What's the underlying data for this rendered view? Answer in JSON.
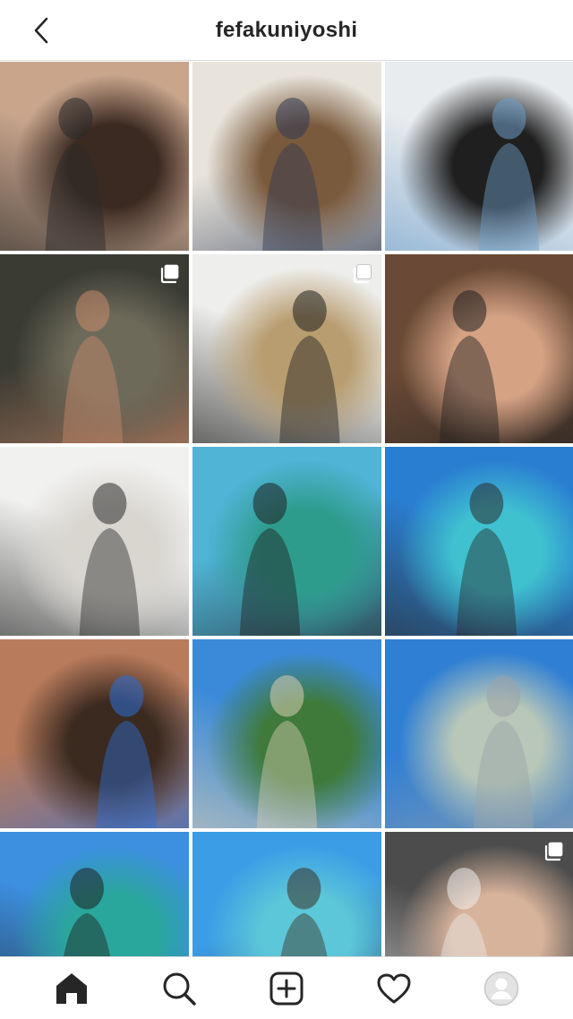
{
  "header": {
    "username": "fefakuniyoshi",
    "back_icon": "chevron-left-icon"
  },
  "posts": [
    {
      "id": 1,
      "multi": false,
      "colors": [
        "#c9a58c",
        "#3b2a22",
        "#2a2a2a"
      ]
    },
    {
      "id": 2,
      "multi": false,
      "colors": [
        "#e8e4dc",
        "#7a5a3c",
        "#2f3a55"
      ]
    },
    {
      "id": 3,
      "multi": false,
      "colors": [
        "#e9ecef",
        "#1f1f1f",
        "#6e9fc9"
      ]
    },
    {
      "id": 4,
      "multi": true,
      "colors": [
        "#3a3b33",
        "#6d6a5a",
        "#c98a6a"
      ]
    },
    {
      "id": 5,
      "multi": true,
      "colors": [
        "#eeeeec",
        "#b89d70",
        "#1f1f1f"
      ]
    },
    {
      "id": 6,
      "multi": false,
      "colors": [
        "#6a4a36",
        "#d5a284",
        "#1f1f1f"
      ]
    },
    {
      "id": 7,
      "multi": false,
      "colors": [
        "#f1f1f0",
        "#d9d6d0",
        "#2b2b2b"
      ]
    },
    {
      "id": 8,
      "multi": false,
      "colors": [
        "#4fb4d6",
        "#2e9c8d",
        "#1f1f1f"
      ]
    },
    {
      "id": 9,
      "multi": false,
      "colors": [
        "#2a7ed1",
        "#3fc1d0",
        "#2b2b2b"
      ]
    },
    {
      "id": 10,
      "multi": false,
      "colors": [
        "#b87b5c",
        "#3b2a20",
        "#2c6ed6"
      ]
    },
    {
      "id": 11,
      "multi": false,
      "colors": [
        "#3b8ad9",
        "#3f7a3a",
        "#d8cdb4"
      ]
    },
    {
      "id": 12,
      "multi": false,
      "colors": [
        "#2f7fd4",
        "#b8c7b8",
        "#9aa3a8"
      ]
    },
    {
      "id": 13,
      "multi": false,
      "colors": [
        "#3d8fe0",
        "#2aa79c",
        "#1f1f1f"
      ]
    },
    {
      "id": 14,
      "multi": false,
      "colors": [
        "#3a9de6",
        "#5cc7d8",
        "#3a3026"
      ]
    },
    {
      "id": 15,
      "multi": true,
      "colors": [
        "#4c4c4c",
        "#d8b39b",
        "#ececec"
      ]
    }
  ],
  "nav": [
    {
      "name": "home",
      "icon": "home-icon",
      "active": true
    },
    {
      "name": "search",
      "icon": "search-icon",
      "active": false
    },
    {
      "name": "new-post",
      "icon": "add-post-icon",
      "active": false
    },
    {
      "name": "activity",
      "icon": "heart-icon",
      "active": false
    },
    {
      "name": "profile",
      "icon": "profile-avatar-icon",
      "active": false
    }
  ]
}
